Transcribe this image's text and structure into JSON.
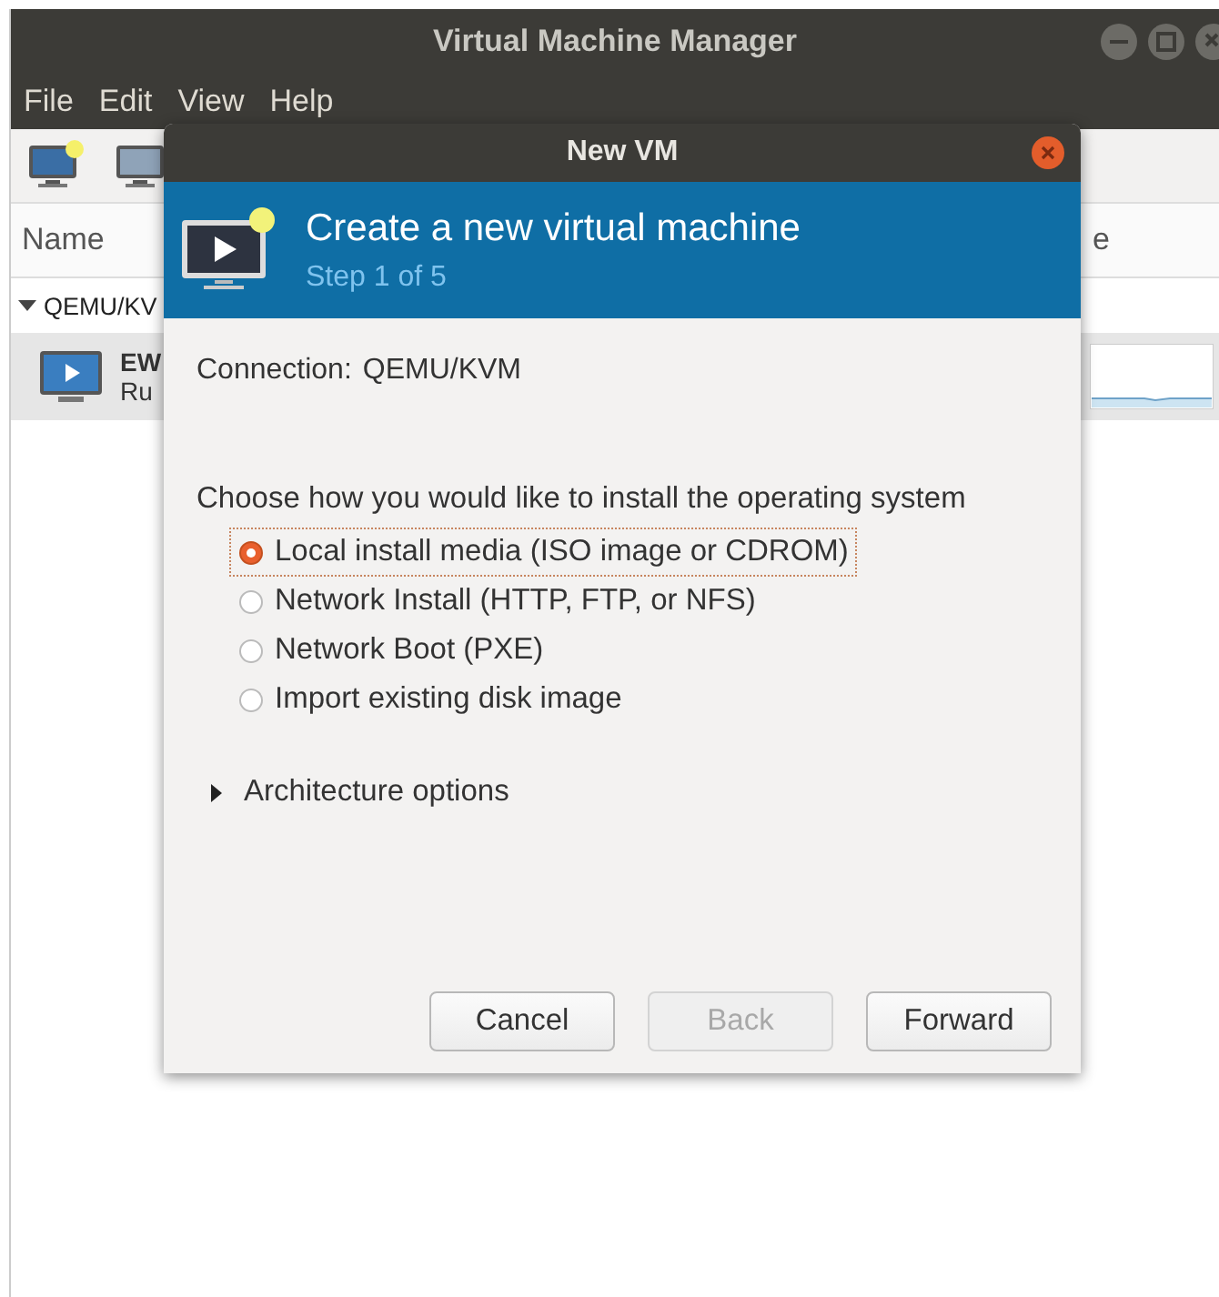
{
  "main_window": {
    "title": "Virtual Machine Manager",
    "menu": [
      "File",
      "Edit",
      "View",
      "Help"
    ],
    "column_header": "Name",
    "column_2_header": "e",
    "group": {
      "label": "QEMU/KV",
      "expanded": true
    },
    "vm": {
      "name": "EW",
      "status": "Ru",
      "selected": true
    }
  },
  "dialog": {
    "title": "New VM",
    "heading": "Create a new virtual machine",
    "step": "Step 1 of 5",
    "connection_label": "Connection:",
    "connection_value": "QEMU/KVM",
    "prompt": "Choose how you would like to install the operating system",
    "options": [
      {
        "label": "Local install media (ISO image or CDROM)",
        "selected": true
      },
      {
        "label": "Network Install (HTTP, FTP, or NFS)",
        "selected": false
      },
      {
        "label": "Network Boot (PXE)",
        "selected": false
      },
      {
        "label": "Import existing disk image",
        "selected": false
      }
    ],
    "expander": {
      "label": "Architecture options",
      "expanded": false
    },
    "buttons": [
      {
        "label": "Cancel",
        "disabled": false
      },
      {
        "label": "Back",
        "disabled": true
      },
      {
        "label": "Forward",
        "disabled": false
      }
    ]
  }
}
